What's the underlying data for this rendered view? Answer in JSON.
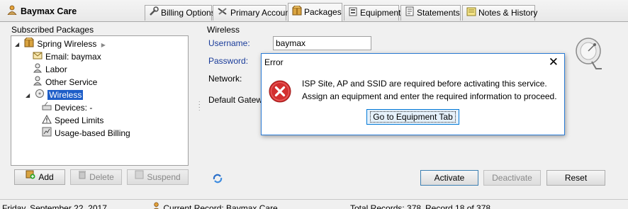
{
  "app": {
    "title": "Baymax Care"
  },
  "tabs": [
    {
      "label": "Billing Options",
      "icon": "wrench-icon"
    },
    {
      "label": "Primary Account",
      "icon": "tools-icon"
    },
    {
      "label": "Packages",
      "icon": "package-icon",
      "active": true
    },
    {
      "label": "Equipment",
      "icon": "equipment-icon"
    },
    {
      "label": "Statements",
      "icon": "statement-icon"
    },
    {
      "label": "Notes & History",
      "icon": "notes-icon"
    }
  ],
  "packages": {
    "group_label": "Subscribed Packages",
    "tree": [
      {
        "label": "Spring Wireless",
        "icon": "package-icon",
        "level": 0,
        "expander": "minus",
        "arrow": "▶"
      },
      {
        "label": "Email: baymax",
        "icon": "envelope-icon",
        "level": 1
      },
      {
        "label": "Labor",
        "icon": "person-icon",
        "level": 1
      },
      {
        "label": "Other Service",
        "icon": "person-icon",
        "level": 1
      },
      {
        "label": "Wireless",
        "icon": "satellite-dish-icon",
        "level": 1,
        "expander": "minus",
        "selected": true
      },
      {
        "label": "Devices: -",
        "icon": "devices-icon",
        "level": 2
      },
      {
        "label": "Speed Limits",
        "icon": "warning-icon",
        "level": 2
      },
      {
        "label": "Usage-based Billing",
        "icon": "meter-icon",
        "level": 2
      }
    ],
    "buttons": {
      "add": "Add",
      "delete": "Delete",
      "suspend": "Suspend"
    }
  },
  "wireless": {
    "group_label": "Wireless",
    "username_label": "Username:",
    "username_value": "baymax",
    "password_label": "Password:",
    "network_label": "Network:",
    "gateway_label": "Default Gatewa",
    "buttons": {
      "activate": "Activate",
      "deactivate": "Deactivate",
      "reset": "Reset"
    }
  },
  "dialog": {
    "title": "Error",
    "close": "✕",
    "line1": "ISP Site, AP and SSID are required before activating this service.",
    "line2": "Assign an equipment and enter the required information to proceed.",
    "button": "Go to Equipment Tab"
  },
  "status": {
    "date": "Friday, September 22, 2017",
    "current_record": "Current Record: Baymax Care",
    "total_records": "Total Records: 378",
    "record_position": "Record 18 of 378"
  },
  "colors": {
    "selection": "#1e5ec8",
    "error_red": "#d32f2f",
    "label_blue": "#1a3c9a",
    "dialog_border": "#2a7bd5"
  }
}
